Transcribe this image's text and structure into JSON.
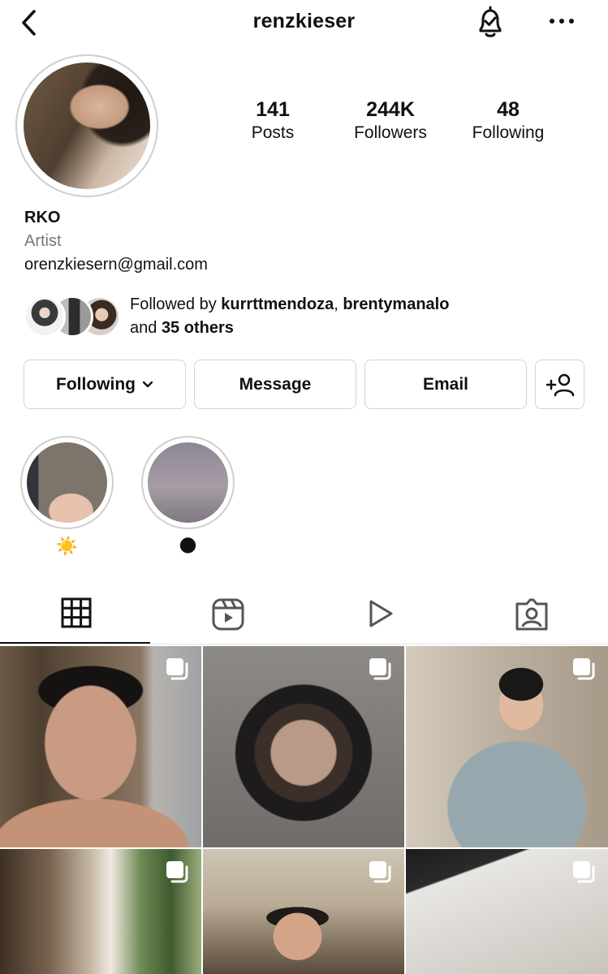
{
  "header": {
    "username": "renzkieser",
    "back_icon": "chevron-left-icon",
    "bell_icon": "bell-check-icon",
    "more_icon": "more-horizontal-icon"
  },
  "stats": [
    {
      "value": "141",
      "label": "Posts"
    },
    {
      "value": "244K",
      "label": "Followers"
    },
    {
      "value": "48",
      "label": "Following"
    }
  ],
  "bio": {
    "name": "RKO",
    "category": "Artist",
    "email": "orenzkiesern@gmail.com"
  },
  "followed_by": {
    "prefix": "Followed by",
    "user1": "kurrttmendoza",
    "comma": ",",
    "user2": "brentymanalo",
    "and": "and",
    "others": "35 others"
  },
  "actions": {
    "following": "Following",
    "message": "Message",
    "email": "Email",
    "add_user_icon": "add-user-icon"
  },
  "highlights": [
    {
      "label": "☀️"
    },
    {
      "label": "🌑"
    }
  ],
  "tabs": [
    "grid-icon",
    "reels-icon",
    "play-icon",
    "tagged-icon"
  ],
  "colors": {
    "text": "#111111",
    "muted": "#777777",
    "border": "#d4d4d4"
  }
}
